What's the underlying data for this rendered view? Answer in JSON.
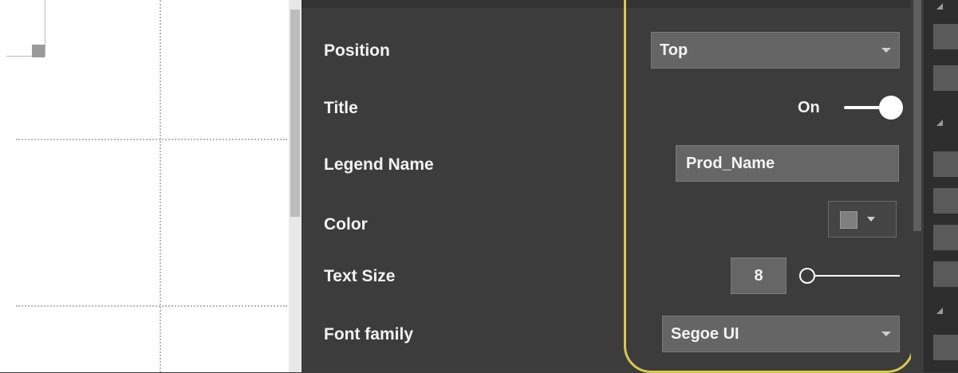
{
  "format_pane": {
    "rows": [
      {
        "label": "Position",
        "control": "dropdown",
        "value": "Top"
      },
      {
        "label": "Title",
        "control": "toggle",
        "value": "On"
      },
      {
        "label": "Legend Name",
        "control": "textbox",
        "value": "Prod_Name"
      },
      {
        "label": "Color",
        "control": "color-picker"
      },
      {
        "label": "Text Size",
        "control": "number-slider",
        "value": "8"
      },
      {
        "label": "Font family",
        "control": "dropdown",
        "value": "Segoe UI"
      }
    ]
  },
  "colors": {
    "panel_bg": "#3c3c3c",
    "highlight": "#d9c84a",
    "control_bg": "#666666",
    "text": "#f2f2f2"
  }
}
